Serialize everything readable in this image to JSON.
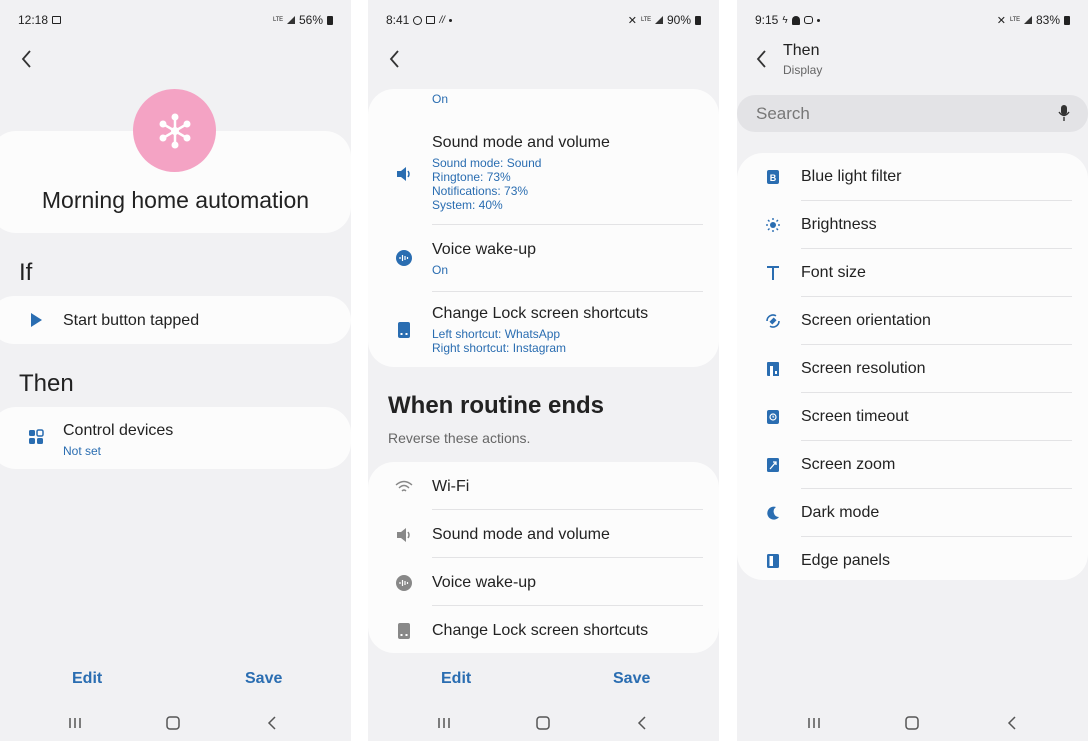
{
  "screen1": {
    "status": {
      "time": "12:18",
      "network": "LTE",
      "battery": "56%"
    },
    "routine_title": "Morning home automation",
    "if_heading": "If",
    "if_item": "Start button tapped",
    "then_heading": "Then",
    "then_item": {
      "title": "Control devices",
      "sub": "Not set"
    },
    "edit_label": "Edit",
    "save_label": "Save",
    "accent_pink": "#f4a3c4",
    "accent_blue": "#2a6db1"
  },
  "screen2": {
    "status": {
      "time": "8:41",
      "network": "LTE",
      "battery": "90%"
    },
    "top_partial_sub": "On",
    "sound": {
      "title": "Sound mode and volume",
      "lines": [
        "Sound mode: Sound",
        "Ringtone: 73%",
        "Notifications: 73%",
        "System: 40%"
      ]
    },
    "voice": {
      "title": "Voice wake-up",
      "sub": "On"
    },
    "lock": {
      "title": "Change Lock screen shortcuts",
      "lines": [
        "Left shortcut: WhatsApp",
        "Right shortcut: Instagram"
      ]
    },
    "ends_heading": "When routine ends",
    "ends_sub": "Reverse these actions.",
    "reverse_items": [
      "Wi-Fi",
      "Sound mode and volume",
      "Voice wake-up",
      "Change Lock screen shortcuts"
    ],
    "edit_label": "Edit",
    "save_label": "Save"
  },
  "screen3": {
    "status": {
      "time": "9:15",
      "network": "LTE",
      "battery": "83%"
    },
    "title": "Then",
    "subtitle": "Display",
    "search_placeholder": "Search",
    "items": [
      "Blue light filter",
      "Brightness",
      "Font size",
      "Screen orientation",
      "Screen resolution",
      "Screen timeout",
      "Screen zoom",
      "Dark mode",
      "Edge panels"
    ]
  }
}
